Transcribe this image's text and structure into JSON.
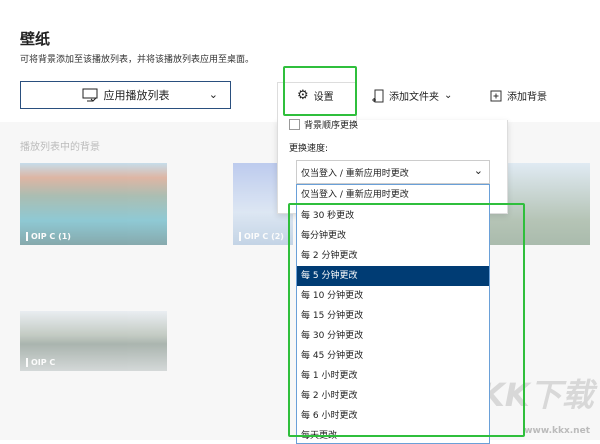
{
  "header": {
    "title": "壁纸",
    "subtitle": "可将背景添加至该播放列表，并将该播放列表应用至桌面。"
  },
  "toolbar": {
    "apply_label": "应用播放列表",
    "settings_label": "设置",
    "add_folder_label": "添加文件夹",
    "add_background_label": "添加背景"
  },
  "panel": {
    "label": "播放列表中的背景",
    "thumbnails": [
      {
        "name": "OIP C (1)"
      },
      {
        "name": "OIP C (2)"
      },
      {
        "name": "OIP C"
      }
    ]
  },
  "settings": {
    "shuffle_label": "背景顺序更换",
    "shuffle_checked": false,
    "speed_label": "更换速度:",
    "speed_value": "仅当登入 / 重新应用时更改",
    "options": [
      "仅当登入 / 重新应用时更改",
      "每 30 秒更改",
      "每分钟更改",
      "每 2 分钟更改",
      "每 5 分钟更改",
      "每 10 分钟更改",
      "每 15 分钟更改",
      "每 30 分钟更改",
      "每 45 分钟更改",
      "每 1 小时更改",
      "每 2 小时更改",
      "每 6 小时更改",
      "每天更改"
    ],
    "highlighted": "每 5 分钟更改"
  },
  "watermark": {
    "logo": "KK下载",
    "url": "www.kkx.net"
  },
  "colors": {
    "accent": "#003c74",
    "highlight_box": "#2fbf3c"
  }
}
